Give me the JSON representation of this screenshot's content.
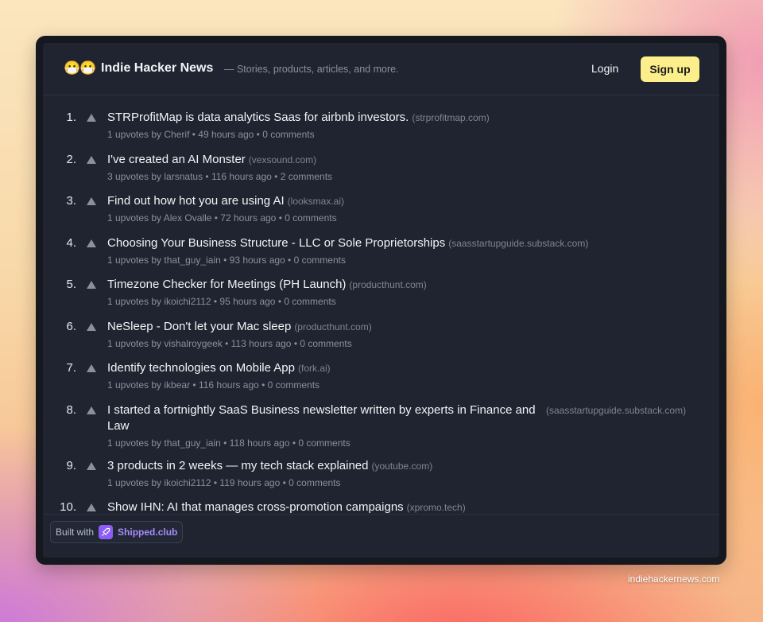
{
  "header": {
    "logo_emoji": "😷😷",
    "title": "Indie Hacker News",
    "tagline": "— Stories, products, articles, and more.",
    "login_label": "Login",
    "signup_label": "Sign up"
  },
  "posts": [
    {
      "rank": "1.",
      "title": "STRProfitMap is data analytics Saas for airbnb investors.",
      "domain": "(strprofitmap.com)",
      "upvotes": "1 upvotes by",
      "author": "Cherif",
      "time": "49 hours ago",
      "comments": "0 comments"
    },
    {
      "rank": "2.",
      "title": "I've created an AI Monster",
      "domain": "(vexsound.com)",
      "upvotes": "3 upvotes by",
      "author": "larsnatus",
      "time": "116 hours ago",
      "comments": "2 comments"
    },
    {
      "rank": "3.",
      "title": "Find out how hot you are using AI",
      "domain": "(looksmax.ai)",
      "upvotes": "1 upvotes by",
      "author": "Alex Ovalle",
      "time": "72 hours ago",
      "comments": "0 comments"
    },
    {
      "rank": "4.",
      "title": "Choosing Your Business Structure - LLC or Sole Proprietorships",
      "domain": "(saasstartupguide.substack.com)",
      "upvotes": "1 upvotes by",
      "author": "that_guy_iain",
      "time": "93 hours ago",
      "comments": "0 comments"
    },
    {
      "rank": "5.",
      "title": "Timezone Checker for Meetings (PH Launch)",
      "domain": "(producthunt.com)",
      "upvotes": "1 upvotes by",
      "author": "ikoichi2112",
      "time": "95 hours ago",
      "comments": "0 comments"
    },
    {
      "rank": "6.",
      "title": "NeSleep - Don't let your Mac sleep",
      "domain": "(producthunt.com)",
      "upvotes": "1 upvotes by",
      "author": "vishalroygeek",
      "time": "113 hours ago",
      "comments": "0 comments"
    },
    {
      "rank": "7.",
      "title": "Identify technologies on Mobile App",
      "domain": "(fork.ai)",
      "upvotes": "1 upvotes by",
      "author": "ikbear",
      "time": "116 hours ago",
      "comments": "0 comments"
    },
    {
      "rank": "8.",
      "title": "I started a fortnightly SaaS Business newsletter written by experts in Finance and Law",
      "domain": "(saasstartupguide.substack.com)",
      "upvotes": "1 upvotes by",
      "author": "that_guy_iain",
      "time": "118 hours ago",
      "comments": "0 comments"
    },
    {
      "rank": "9.",
      "title": "3 products in 2 weeks — my tech stack explained",
      "domain": "(youtube.com)",
      "upvotes": "1 upvotes by",
      "author": "ikoichi2112",
      "time": "119 hours ago",
      "comments": "0 comments"
    },
    {
      "rank": "10.",
      "title": "Show IHN: AI that manages cross-promotion campaigns",
      "domain": "(xpromo.tech)",
      "upvotes": "",
      "author": "",
      "time": "",
      "comments": ""
    }
  ],
  "footer": {
    "built_with_label": "Built with",
    "shipped_name": "Shipped.club"
  },
  "site_url": "indiehackernews.com"
}
